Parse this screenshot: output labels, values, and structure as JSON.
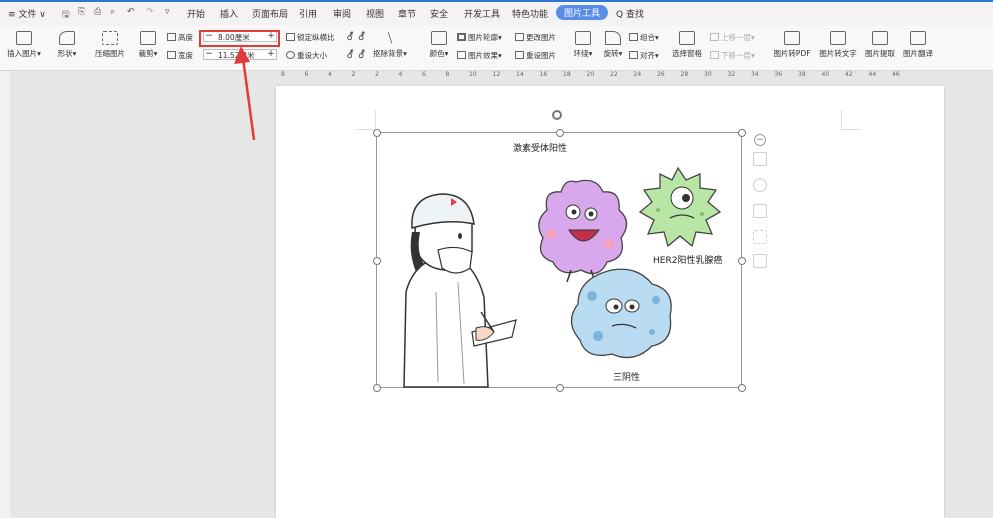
{
  "menubar": {
    "file_label": "≡ 文件 ∨",
    "tabs": [
      "开始",
      "插入",
      "页面布局",
      "引用",
      "审阅",
      "视图",
      "章节",
      "安全",
      "开发工具",
      "特色功能"
    ],
    "active_tab": "图片工具",
    "search_label": "Q 查找"
  },
  "ribbon": {
    "insert_image": "插入图片",
    "shape": "形状",
    "compress": "压缩图片",
    "crop": "裁剪",
    "height_label": "高度",
    "height_value": "8.00厘米",
    "width_label": "宽度",
    "width_value": "11.52厘米",
    "lock_ratio": "锁定纵横比",
    "reset_size": "重设大小",
    "remove_bg": "抠除背景",
    "color": "颜色",
    "outline": "图片轮廓",
    "effects": "图片效果",
    "change_image": "更改图片",
    "reset_image": "重设图片",
    "wrap": "环绕",
    "rotate": "旋转",
    "group": "组合",
    "align": "对齐",
    "selection_pane": "选择窗格",
    "bring_forward": "上移一层",
    "send_backward": "下移一层",
    "to_pdf": "图片转PDF",
    "to_text": "图片转文字",
    "extract": "图片提取",
    "translate": "图片翻译"
  },
  "ruler_labels": [
    "8",
    "6",
    "4",
    "2",
    "2",
    "4",
    "6",
    "8",
    "10",
    "12",
    "14",
    "16",
    "18",
    "20",
    "22",
    "24",
    "26",
    "28",
    "30",
    "32",
    "34",
    "36",
    "38",
    "40",
    "42",
    "44",
    "46"
  ],
  "image": {
    "label_top": "激素受体阳性",
    "label_right": "HER2阳性乳腺癌",
    "label_bottom": "三阴性"
  },
  "colors": {
    "accent": "#5a8ee6",
    "highlight": "#e53935",
    "purple_cell": "#d9a8ec",
    "green_cell": "#b8e6a4",
    "blue_cell": "#b9dcf2"
  }
}
